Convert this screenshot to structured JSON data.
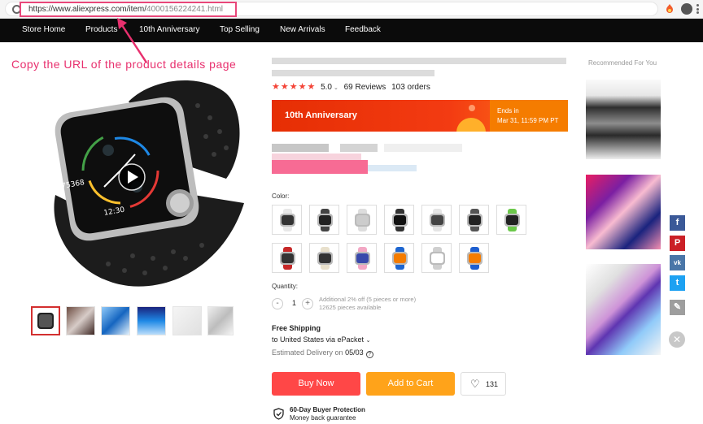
{
  "browser": {
    "url_main": "https://www.aliexpress.com/item/",
    "url_tail": "4000156224241.html"
  },
  "nav": {
    "items": [
      "Store Home",
      "Products",
      "10th Anniversary",
      "Top Selling",
      "New Arrivals",
      "Feedback"
    ]
  },
  "annotation": "Copy the URL of the product details page",
  "product": {
    "rating": "5.0",
    "reviews": "69 Reviews",
    "orders": "103 orders",
    "promo_title": "10th Anniversary",
    "ends_label": "Ends in",
    "ends_date": "Mar 31, 11:59 PM PT",
    "color_label": "Color:",
    "quantity_label": "Quantity:",
    "quantity": "1",
    "qty_minus": "-",
    "qty_plus": "+",
    "qty_note1": "Additional 2% off (5 pieces or more)",
    "qty_note2": "12625 pieces available",
    "ship_title": "Free Shipping",
    "ship_to": "to United States via ePacket",
    "delivery_label": "Estimated Delivery on",
    "delivery_date": "05/03",
    "buy_now": "Buy Now",
    "add_to_cart": "Add to Cart",
    "wish_count": "131",
    "protect_title": "60-Day Buyer Protection",
    "protect_sub": "Money back guarantee"
  },
  "swatch_colors": [
    {
      "band": "#e8e8e8",
      "face": "#333"
    },
    {
      "band": "#444",
      "face": "#222"
    },
    {
      "band": "#ddd",
      "face": "#ccc"
    },
    {
      "band": "#333",
      "face": "#111"
    },
    {
      "band": "#e5e5e5",
      "face": "#444"
    },
    {
      "band": "#555",
      "face": "#222"
    },
    {
      "band": "#6bc84a",
      "face": "#222"
    },
    {
      "band": "#c62828",
      "face": "#333"
    },
    {
      "band": "#e8e0cc",
      "face": "#333"
    },
    {
      "band": "#f3a7c4",
      "face": "#3949ab"
    },
    {
      "band": "#1e66d0",
      "face": "#f57c00"
    },
    {
      "band": "#cfcfcf",
      "face": "#fff"
    },
    {
      "band": "#1e5fd0",
      "face": "#f57c00"
    }
  ],
  "recommended": {
    "title": "Recommended For You"
  },
  "social": {
    "facebook": "f",
    "pinterest": "P",
    "vk": "vk",
    "twitter": "t",
    "edit": "✎",
    "close": "✕"
  },
  "colors": {
    "accent_red": "#ff4747",
    "accent_orange": "#ffa31a",
    "annotation_pink": "#e8306e"
  }
}
